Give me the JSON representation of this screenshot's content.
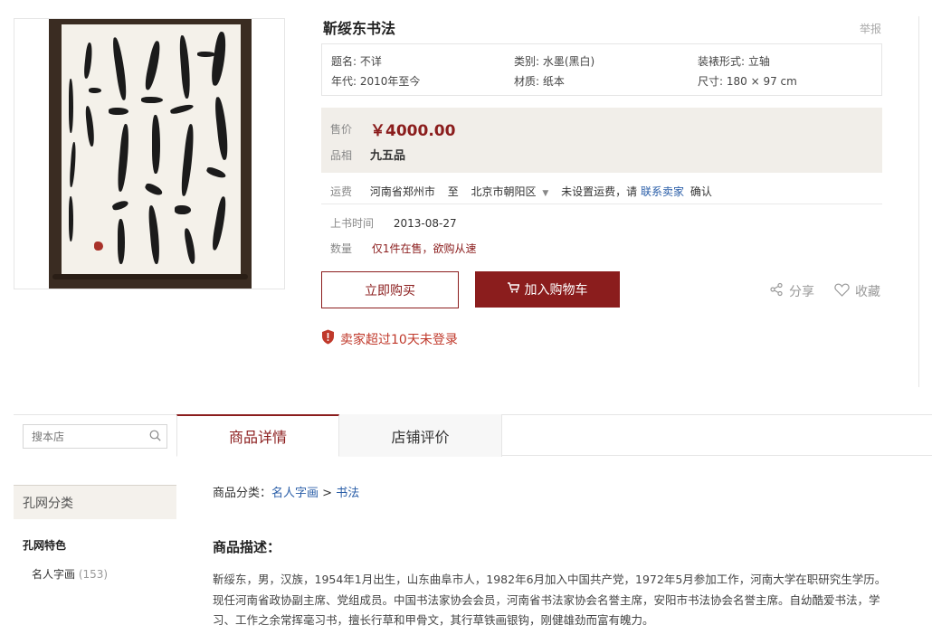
{
  "product": {
    "title": "靳绥东书法",
    "report": "举报",
    "attributes": [
      {
        "label": "题名: 不详"
      },
      {
        "label": "类别: 水墨(黑白)"
      },
      {
        "label": "装裱形式: 立轴"
      },
      {
        "label": "年代: 2010年至今"
      },
      {
        "label": "材质: 纸本"
      },
      {
        "label": "尺寸: 180 × 97 cm"
      }
    ],
    "price_label": "售价",
    "price": "￥4000.00",
    "grade_label": "品相",
    "grade": "九五品",
    "shipping_label": "运费",
    "shipping_from": "河南省郑州市",
    "shipping_to_word": "至",
    "shipping_to": "北京市朝阳区",
    "shipping_note_pre": "未设置运费，请",
    "shipping_contact": "联系卖家",
    "shipping_note_post": "确认",
    "listed_label": "上书时间",
    "listed_date": "2013-08-27",
    "qty_label": "数量",
    "qty_value": "仅1件在售，欲购从速",
    "buy_now": "立即购买",
    "add_cart": "加入购物车",
    "share": "分享",
    "favorite": "收藏",
    "warning": "卖家超过10天未登录"
  },
  "tabs": [
    {
      "label": "商品详情"
    },
    {
      "label": "店铺评价"
    }
  ],
  "sidebar": {
    "search_placeholder": "搜本店",
    "category_header": "孔网分类",
    "group": "孔网特色",
    "item_label": "名人字画",
    "item_count": "(153)"
  },
  "detail": {
    "breadcrumb_prefix": "商品分类：",
    "breadcrumb_cat": "名人字画",
    "breadcrumb_sep": " > ",
    "breadcrumb_sub": "书法",
    "desc_title": "商品描述：",
    "desc_body": "靳绥东，男，汉族，1954年1月出生，山东曲阜市人，1982年6月加入中国共产党，1972年5月参加工作，河南大学在职研究生学历。现任河南省政协副主席、党组成员。中国书法家协会会员，河南省书法家协会名誉主席，安阳市书法协会名誉主席。自幼酷爱书法，学习、工作之余常挥毫习书，擅长行草和甲骨文，其行草铁画银钩，刚健雄劲而富有魄力。"
  },
  "colors": {
    "accent": "#8b1d1d",
    "link": "#2a5ea8",
    "warning": "#c0392b",
    "price_bg": "#f1eee9"
  }
}
